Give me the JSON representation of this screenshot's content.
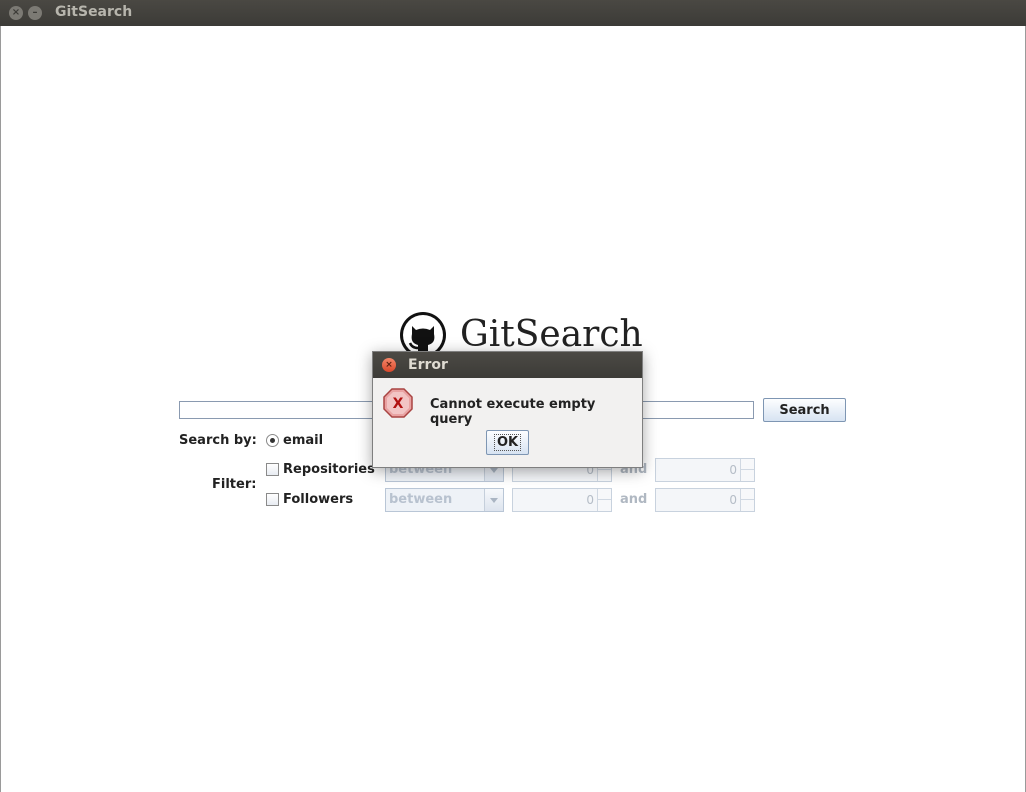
{
  "window": {
    "title": "GitSearch",
    "close_glyph": "×",
    "minimize_glyph": "–"
  },
  "logo": {
    "icon": "github-octocat-icon",
    "text": "GitSearch"
  },
  "search": {
    "query_value": "",
    "button_label": "Search"
  },
  "search_by": {
    "label": "Search by:",
    "options": [
      {
        "label": "email",
        "selected": true
      }
    ]
  },
  "filter": {
    "label": "Filter:",
    "and_label": "and",
    "rows": [
      {
        "label": "Repositories",
        "checked": false,
        "operator": "between",
        "min": "0",
        "max": "0"
      },
      {
        "label": "Followers",
        "checked": false,
        "operator": "between",
        "min": "0",
        "max": "0"
      }
    ]
  },
  "dialog": {
    "title": "Error",
    "close_glyph": "×",
    "icon": "error-icon",
    "icon_glyph": "X",
    "message": "Cannot execute empty query",
    "ok_label": "OK"
  },
  "colors": {
    "titlebar": "#3c3b37",
    "button_gradient_bottom": "#d7e3f2",
    "error_icon": "#d9534f",
    "dialog_close": "#e0613f"
  }
}
